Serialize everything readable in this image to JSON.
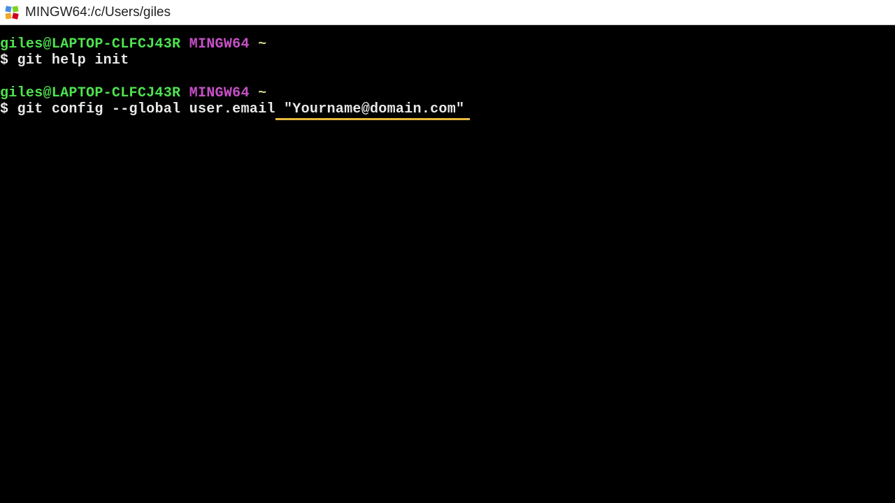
{
  "window": {
    "title": "MINGW64:/c/Users/giles"
  },
  "prompt_segments": {
    "user_host": "giles@LAPTOP-CLFCJ43R",
    "env": "MINGW64",
    "path": "~",
    "symbol": "$"
  },
  "lines": {
    "cmd1": " git help init",
    "cmd2_pre": " git config --global user.email",
    "cmd2_highlight": " \"Yourname@domain.com\""
  }
}
